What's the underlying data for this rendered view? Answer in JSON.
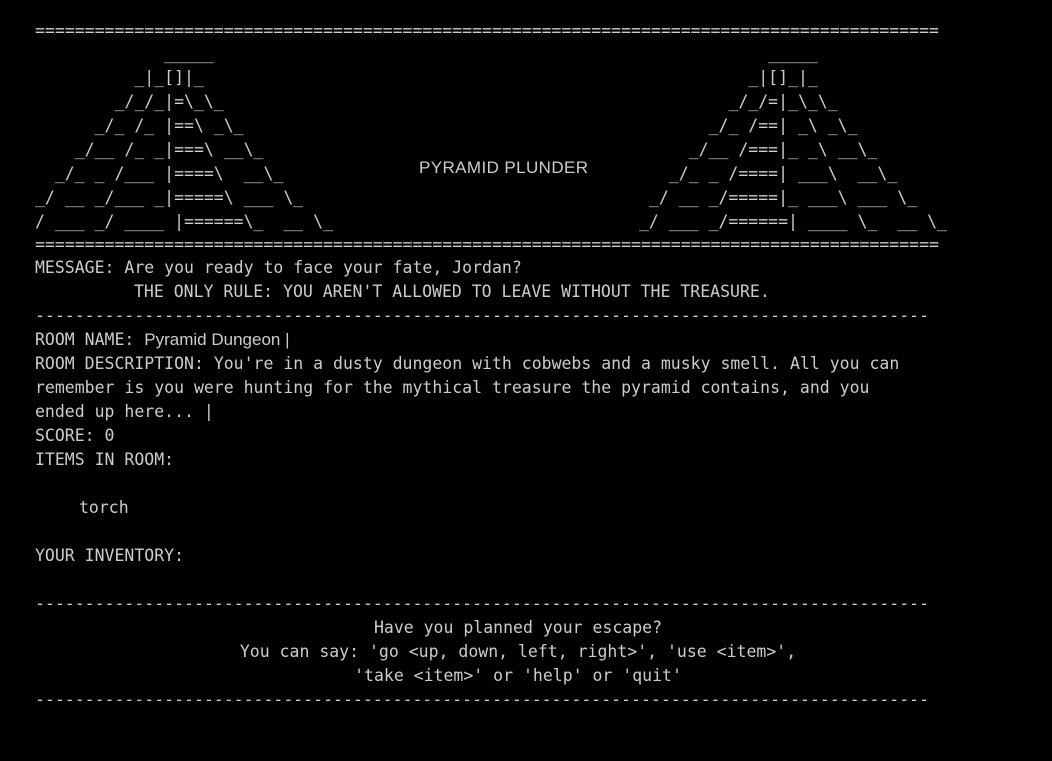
{
  "window": {
    "background": "#000000",
    "foreground": "#cccccc"
  },
  "banner": {
    "rule_top": "===========================================================================================",
    "rule_bottom": "===========================================================================================",
    "title": "PYRAMID PLUNDER",
    "left_art": "             _____\n          _|_[]|_\n        _/_/_|=\\_\\_\n      _/_ /_ |==\\ _\\_\n    _/__ /_ _|===\\ __\\_\n  _/_ _ /___ |====\\  __\\_\n_/ __ _/___ _|=====\\ ___ \\_\n/ ___ _/ ____ |======\\_  __ \\_",
    "right_art": "             _____\n           _|[]_|_\n         _/_/=|_\\_\\_\n       _/_ /==| _\\ _\\_\n     _/__ /===|_ _\\ __\\_\n   _/_ _ /====| ___\\  __\\_\n _/ __ _/=====|_ ___\\ ___ \\_\n_/ ___ _/======| ____ \\_  __ \\_"
  },
  "message": {
    "label": "MESSAGE: ",
    "text": "Are you ready to face your fate, Jordan?",
    "rule_text": "THE ONLY RULE: YOU AREN'T ALLOWED TO LEAVE WITHOUT THE TREASURE."
  },
  "divider": "------------------------------------------------------------------------------------------",
  "room": {
    "name_label": "ROOM NAME: ",
    "name": "Pyramid Dungeon |",
    "description_label": "ROOM DESCRIPTION: ",
    "description_line1": "You're in a dusty dungeon with cobwebs and a musky smell. All you can",
    "description_line2": "remember is you were hunting for the mythical treasure the pyramid contains, and you",
    "description_line3": "ended up here... |",
    "score_label": "SCORE: ",
    "score": "0",
    "items_label": "ITEMS IN ROOM:",
    "items": [
      "torch"
    ]
  },
  "inventory": {
    "label": "YOUR INVENTORY:",
    "items": []
  },
  "prompt": {
    "line1": "Have you planned your escape?",
    "line2": "You can say: 'go <up, down, left, right>', 'use <item>',",
    "line3": "'take <item>' or 'help' or 'quit'"
  }
}
